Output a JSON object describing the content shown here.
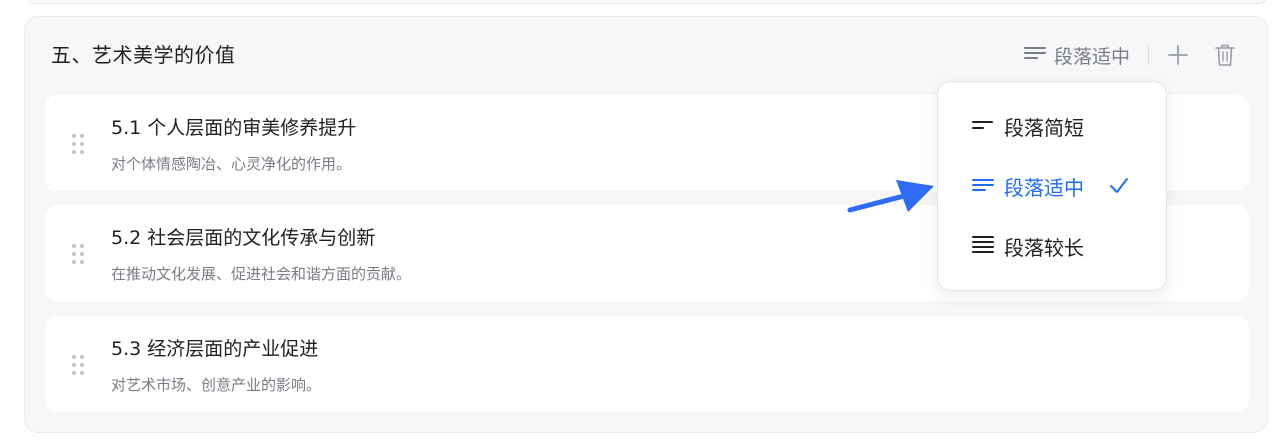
{
  "section": {
    "title": "五、艺术美学的价值",
    "length_button_label": "段落适中"
  },
  "items": [
    {
      "title": "5.1 个人层面的审美修养提升",
      "desc": "对个体情感陶冶、心灵净化的作用。"
    },
    {
      "title": "5.2 社会层面的文化传承与创新",
      "desc": "在推动文化发展、促进社会和谐方面的贡献。"
    },
    {
      "title": "5.3 经济层面的产业促进",
      "desc": "对艺术市场、创意产业的影响。"
    }
  ],
  "dropdown": {
    "options": [
      {
        "label": "段落简短",
        "icon": "short-lines-icon"
      },
      {
        "label": "段落适中",
        "icon": "medium-lines-icon",
        "selected": true
      },
      {
        "label": "段落较长",
        "icon": "long-lines-icon"
      }
    ],
    "selected_color": "#1f6ef0"
  },
  "colors": {
    "accent": "#1f6ef0",
    "section_bg": "#f6f7f9",
    "muted_text": "#7a7d85"
  }
}
